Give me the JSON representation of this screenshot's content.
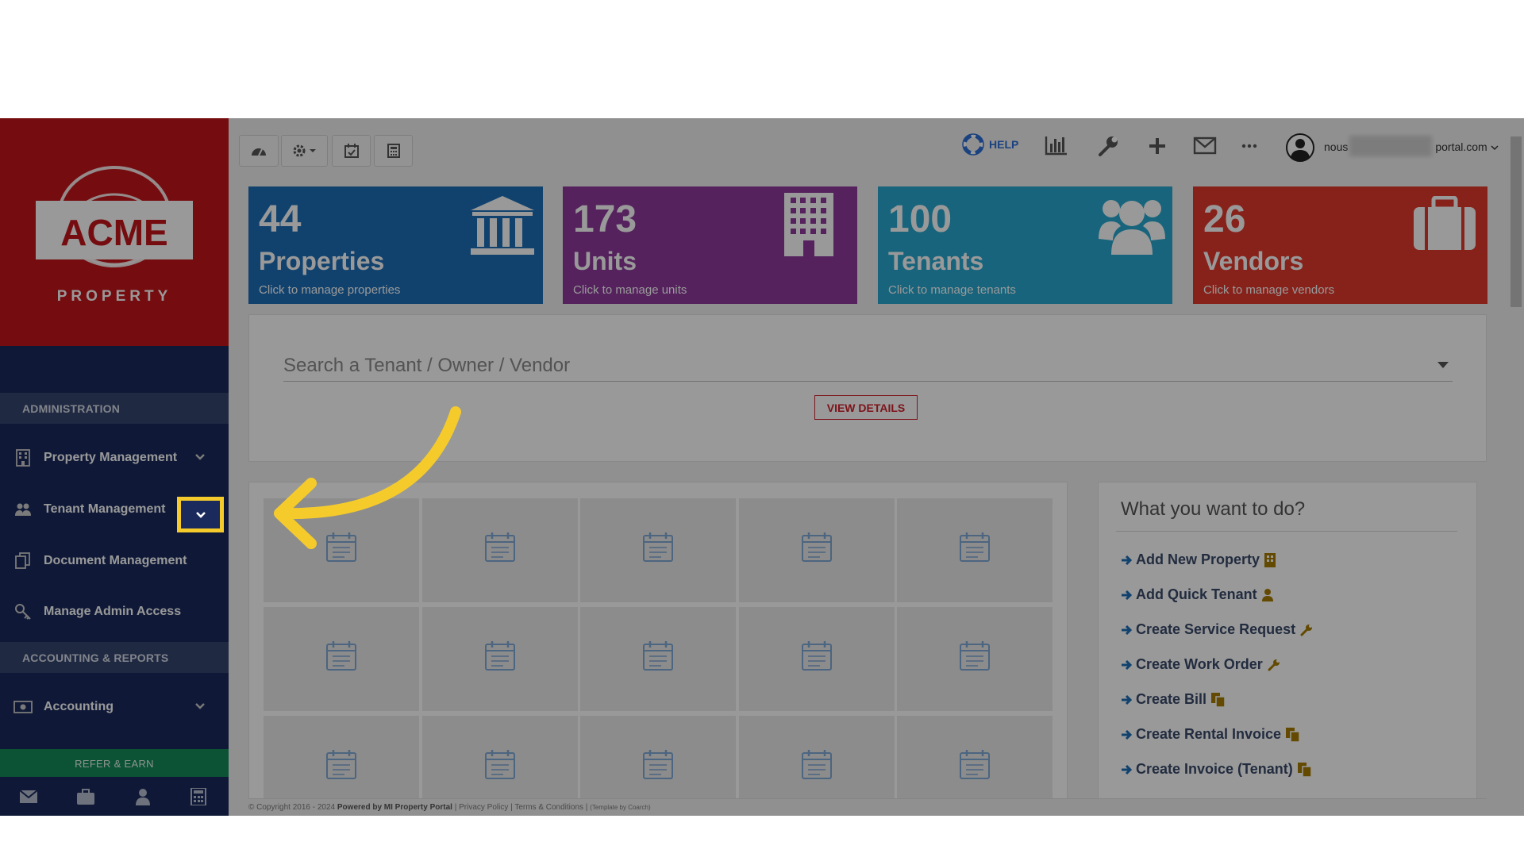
{
  "brand": {
    "logo_text": "ACME",
    "logo_subtext": "PROPERTY"
  },
  "sidebar": {
    "sections": [
      {
        "title": "ADMINISTRATION",
        "items": [
          {
            "label": "Property Management",
            "icon": "building-icon",
            "has_chevron": true
          },
          {
            "label": "Tenant Management",
            "icon": "users-icon",
            "has_chevron": true,
            "highlighted": true
          },
          {
            "label": "Document Management",
            "icon": "copy-icon",
            "has_chevron": false
          },
          {
            "label": "Manage Admin Access",
            "icon": "key-icon",
            "has_chevron": false
          }
        ]
      },
      {
        "title": "ACCOUNTING & REPORTS",
        "items": [
          {
            "label": "Accounting",
            "icon": "money-icon",
            "has_chevron": true
          }
        ]
      }
    ],
    "refer_label": "REFER & EARN",
    "bottom_icons": [
      "envelope-icon",
      "briefcase-icon",
      "user-icon",
      "calculator-icon"
    ]
  },
  "toolbar": {
    "left_buttons": [
      "dashboard-icon",
      "gear-dropdown-icon",
      "calendar-check-icon",
      "calculator-icon"
    ],
    "help_label": "HELP",
    "right_icons": [
      "bar-chart-icon",
      "wrench-icon",
      "plus-icon",
      "envelope-icon",
      "more-icon"
    ],
    "user_email_start": "nous",
    "user_email_end": "portal.com"
  },
  "stats": [
    {
      "number": "44",
      "label": "Properties",
      "subtitle": "Click to manage properties",
      "color": "#1d6fb8",
      "icon": "bank-icon"
    },
    {
      "number": "173",
      "label": "Units",
      "subtitle": "Click to manage units",
      "color": "#8e3a9d",
      "icon": "building-icon"
    },
    {
      "number": "100",
      "label": "Tenants",
      "subtitle": "Click to manage tenants",
      "color": "#27a7cf",
      "icon": "users-icon"
    },
    {
      "number": "26",
      "label": "Vendors",
      "subtitle": "Click to manage vendors",
      "color": "#e23a2e",
      "icon": "briefcase-icon"
    }
  ],
  "search": {
    "placeholder": "Search a Tenant / Owner / Vendor",
    "button_label": "VIEW DETAILS"
  },
  "actions": {
    "title": "What you want to do?",
    "items": [
      {
        "label": "Add New Property",
        "icon": "building-icon"
      },
      {
        "label": "Add Quick Tenant",
        "icon": "user-icon"
      },
      {
        "label": "Create Service Request",
        "icon": "wrench-icon"
      },
      {
        "label": "Create Work Order",
        "icon": "wrench-icon"
      },
      {
        "label": "Create Bill",
        "icon": "copy-icon"
      },
      {
        "label": "Create Rental Invoice",
        "icon": "copy-icon"
      },
      {
        "label": "Create Invoice (Tenant)",
        "icon": "copy-icon"
      }
    ]
  },
  "footer": {
    "copyright": "© Copyright 2016 - 2024",
    "powered_by": "Powered by MI Property Portal",
    "privacy": "Privacy Policy",
    "terms": "Terms & Conditions",
    "template": "(Template by Coarch)"
  },
  "colors": {
    "sidebar_bg": "#1a2a5c",
    "logo_bg": "#c4161c",
    "highlight": "#f5cb2c",
    "accent_red": "#d0222c"
  }
}
